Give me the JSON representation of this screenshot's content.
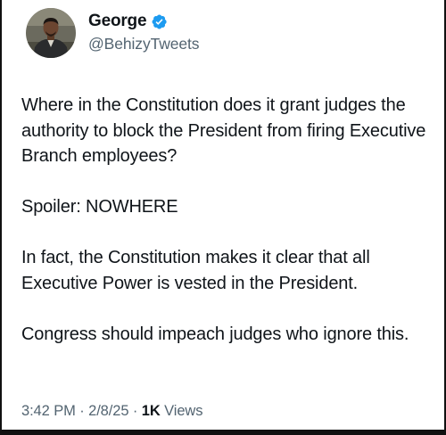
{
  "tweet": {
    "author": {
      "display_name": "George",
      "handle": "@BehizyTweets",
      "verified": true,
      "verified_icon": "verified-badge-icon",
      "avatar": "profile-photo-avatar"
    },
    "paragraphs": [
      "Where in the Constitution does it grant judges the authority to block the President from firing Executive Branch employees?",
      "Spoiler: NOWHERE",
      "In fact, the Constitution makes it clear that all Executive Power is vested in the President.",
      "Congress should impeach judges who ignore this."
    ],
    "meta": {
      "time": "3:42 PM",
      "separator": "·",
      "date": "2/8/25",
      "views_count": "1K",
      "views_label": "Views"
    }
  },
  "colors": {
    "text_primary": "#0f1419",
    "text_secondary": "#536471",
    "verified_blue": "#1d9bf0"
  }
}
